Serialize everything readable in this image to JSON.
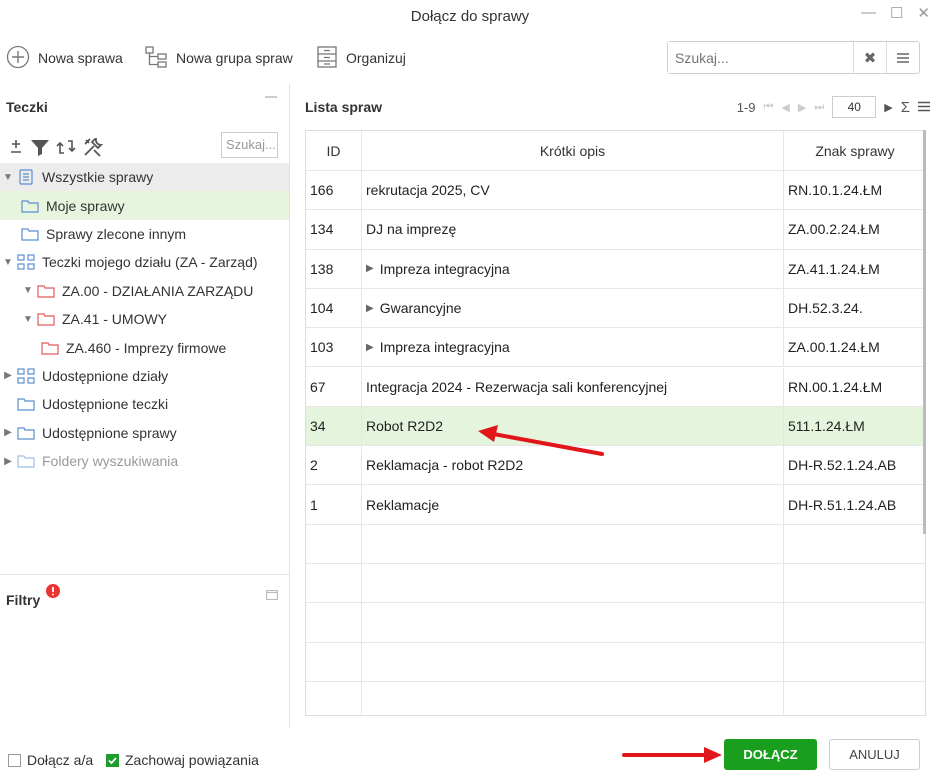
{
  "window": {
    "title": "Dołącz do sprawy"
  },
  "toolbar": {
    "new_case": "Nowa sprawa",
    "new_group": "Nowa grupa spraw",
    "organize": "Organizuj"
  },
  "search": {
    "placeholder": "Szukaj..."
  },
  "left": {
    "title": "Teczki",
    "search_placeholder": "Szukaj...",
    "tree": [
      {
        "label": "Wszystkie sprawy"
      },
      {
        "label": "Moje sprawy"
      },
      {
        "label": "Sprawy zlecone innym"
      },
      {
        "label": "Teczki mojego działu (ZA - Zarząd)"
      },
      {
        "label": "ZA.00 - DZIAŁANIA ZARZĄDU"
      },
      {
        "label": "ZA.41 - UMOWY"
      },
      {
        "label": "ZA.460 - Imprezy firmowe"
      },
      {
        "label": "Udostępnione działy"
      },
      {
        "label": "Udostępnione teczki"
      },
      {
        "label": "Udostępnione sprawy"
      },
      {
        "label": "Foldery wyszukiwania"
      }
    ],
    "filters_title": "Filtry"
  },
  "list": {
    "title": "Lista spraw",
    "range": "1-9",
    "page_size": "40",
    "headers": {
      "id": "ID",
      "desc": "Krótki opis",
      "sign": "Znak sprawy"
    },
    "rows": [
      {
        "id": "166",
        "desc": "rekrutacja 2025, CV",
        "sign": "RN.10.1.24.ŁM"
      },
      {
        "id": "134",
        "desc": "DJ na imprezę",
        "sign": "ZA.00.2.24.ŁM"
      },
      {
        "id": "138",
        "desc": "Impreza integracyjna",
        "sign": "ZA.41.1.24.ŁM"
      },
      {
        "id": "104",
        "desc": "Gwarancyjne",
        "sign": "DH.52.3.24."
      },
      {
        "id": "103",
        "desc": "Impreza integracyjna",
        "sign": "ZA.00.1.24.ŁM"
      },
      {
        "id": "67",
        "desc": "Integracja 2024 - Rezerwacja sali konferencyjnej",
        "sign": "RN.00.1.24.ŁM"
      },
      {
        "id": "34",
        "desc": "Robot R2D2",
        "sign": "511.1.24.ŁM"
      },
      {
        "id": "2",
        "desc": "Reklamacja - robot R2D2",
        "sign": "DH-R.52.1.24.AB"
      },
      {
        "id": "1",
        "desc": "Reklamacje",
        "sign": "DH-R.51.1.24.AB"
      }
    ]
  },
  "footer": {
    "attach_aa": "Dołącz a/a",
    "keep_links": "Zachowaj powiązania",
    "ok": "DOŁĄCZ",
    "cancel": "ANULUJ"
  },
  "colors": {
    "accent": "#1a9e1d",
    "highlight": "#e5f4dc",
    "arrow": "#e0161b"
  }
}
